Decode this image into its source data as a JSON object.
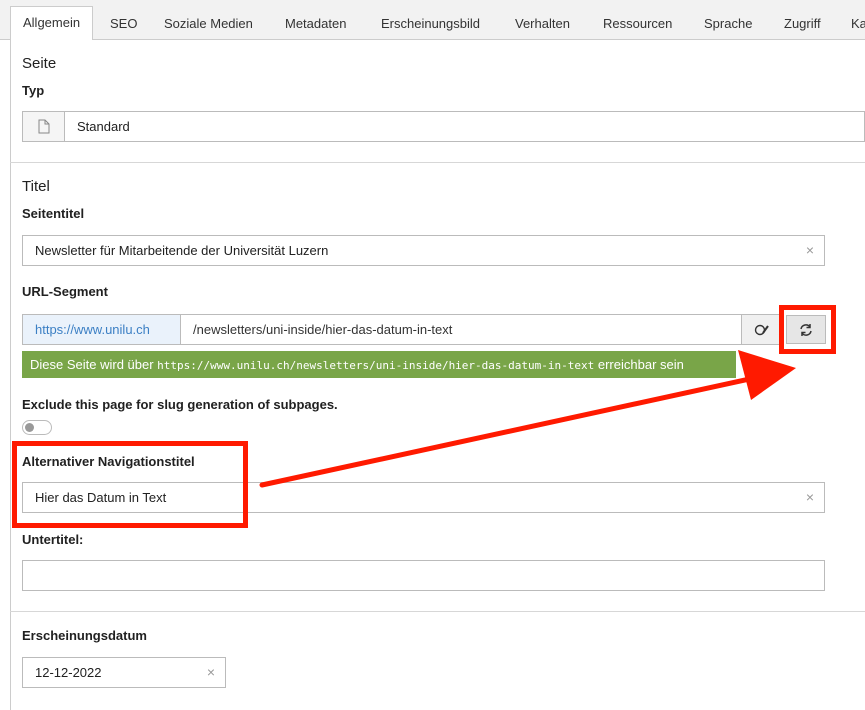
{
  "tabs": [
    "Allgemein",
    "SEO",
    "Soziale Medien",
    "Metadaten",
    "Erscheinungsbild",
    "Verhalten",
    "Ressourcen",
    "Sprache",
    "Zugriff",
    "Ka"
  ],
  "sections": {
    "page": {
      "title": "Seite",
      "type_label": "Typ",
      "type_value": "Standard"
    },
    "titel": {
      "title": "Titel",
      "page_title_label": "Seitentitel",
      "page_title_value": "Newsletter für Mitarbeitende der Universität Luzern",
      "url_segment_label": "URL-Segment",
      "url_prefix": "https://www.unilu.ch",
      "url_path": "/newsletters/uni-inside/hier-das-datum-in-text",
      "info_prefix": "Diese Seite wird über ",
      "info_url": "https://www.unilu.ch/newsletters/uni-inside/hier-das-datum-in-text",
      "info_suffix": " erreichbar sein",
      "exclude_label": "Exclude this page for slug generation of subpages.",
      "nav_title_label": "Alternativer Navigationstitel",
      "nav_title_value": "Hier das Datum in Text",
      "subtitle_label": "Untertitel:",
      "subtitle_value": ""
    },
    "date": {
      "label": "Erscheinungsdatum",
      "value": "12-12-2022"
    }
  },
  "icons": {
    "clear": "×",
    "type_icon": "page-icon",
    "edit_icon": "pencil-toggle-icon",
    "regen_icon": "refresh-icon"
  },
  "colors": {
    "accent_red": "#ff1a00",
    "info_green": "#79a548",
    "prefix_blue": "#3b7fc4"
  }
}
